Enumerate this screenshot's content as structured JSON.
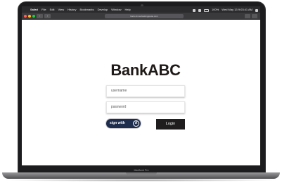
{
  "device": {
    "model_label": "MacBook Pro"
  },
  "menubar": {
    "apple_glyph": "",
    "items": [
      "Safari",
      "File",
      "Edit",
      "View",
      "History",
      "Bookmarks",
      "Develop",
      "Window",
      "Help"
    ],
    "battery_text": "100%",
    "clock": "Wed May 13 9:03:41 AM"
  },
  "browser": {
    "url": "bank.rtmoutlookingquote.com",
    "back_glyph": "‹",
    "forward_glyph": "›"
  },
  "page": {
    "logo": "BankABC",
    "username_placeholder": "username",
    "password_placeholder": "password",
    "sign_with_label": "sign with",
    "sign_with_badge": "A",
    "login_label": "Login",
    "colors": {
      "sign_with_bg": "#1e2d4d",
      "login_bg": "#1f1d1d",
      "logo": "#1f1a17"
    }
  }
}
